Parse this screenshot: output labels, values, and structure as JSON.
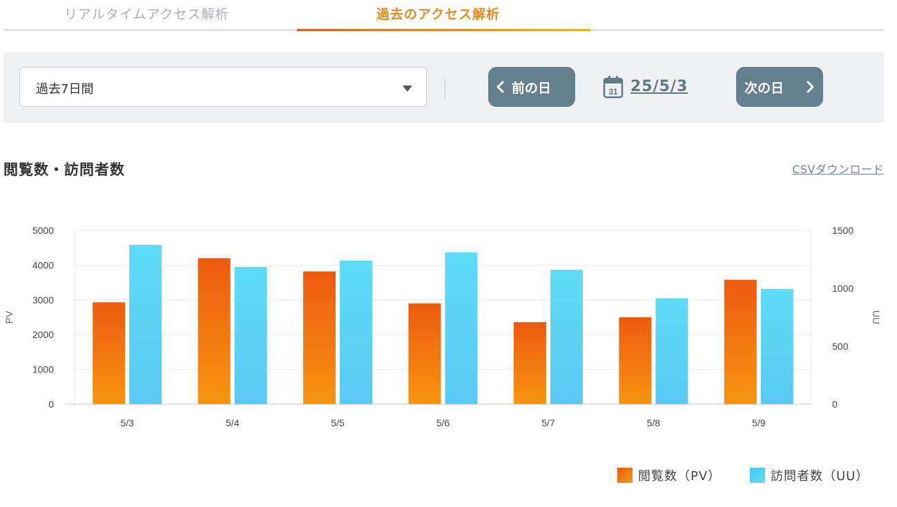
{
  "tabs": [
    {
      "label": "リアルタイムアクセス解析",
      "active": false
    },
    {
      "label": "過去のアクセス解析",
      "active": true
    }
  ],
  "filter": {
    "period": "過去7日間",
    "prev_label": "前の日",
    "next_label": "次の日",
    "calendar_day": "31",
    "date": "25/5/3"
  },
  "section": {
    "title": "閲覧数・訪問者数",
    "csv_label": "CSVダウンロード"
  },
  "colors": {
    "pv_top": "#ee5a10",
    "pv_bottom": "#f7950f",
    "uu_top": "#5fdcf6",
    "uu_bottom": "#58c9f3",
    "accent": "#e88a1e",
    "button": "#63808d"
  },
  "chart_data": {
    "type": "bar",
    "categories": [
      "5/3",
      "5/4",
      "5/5",
      "5/6",
      "5/7",
      "5/8",
      "5/9"
    ],
    "series": [
      {
        "name": "閲覧数（PV）",
        "axis": "left",
        "values": [
          2930,
          4200,
          3820,
          2900,
          2360,
          2500,
          3580
        ]
      },
      {
        "name": "訪問者数（UU）",
        "axis": "right",
        "values": [
          1375,
          1185,
          1240,
          1310,
          1160,
          915,
          995
        ]
      }
    ],
    "ylabel": "PV",
    "y2label": "UU",
    "ylim": [
      0,
      5000
    ],
    "y2lim": [
      0,
      1500
    ],
    "yticks": [
      "0",
      "1000",
      "2000",
      "3000",
      "4000",
      "5000"
    ],
    "y2ticks": [
      "0",
      "500",
      "1000",
      "1500"
    ],
    "grid": true,
    "legend": "bottom-right"
  }
}
